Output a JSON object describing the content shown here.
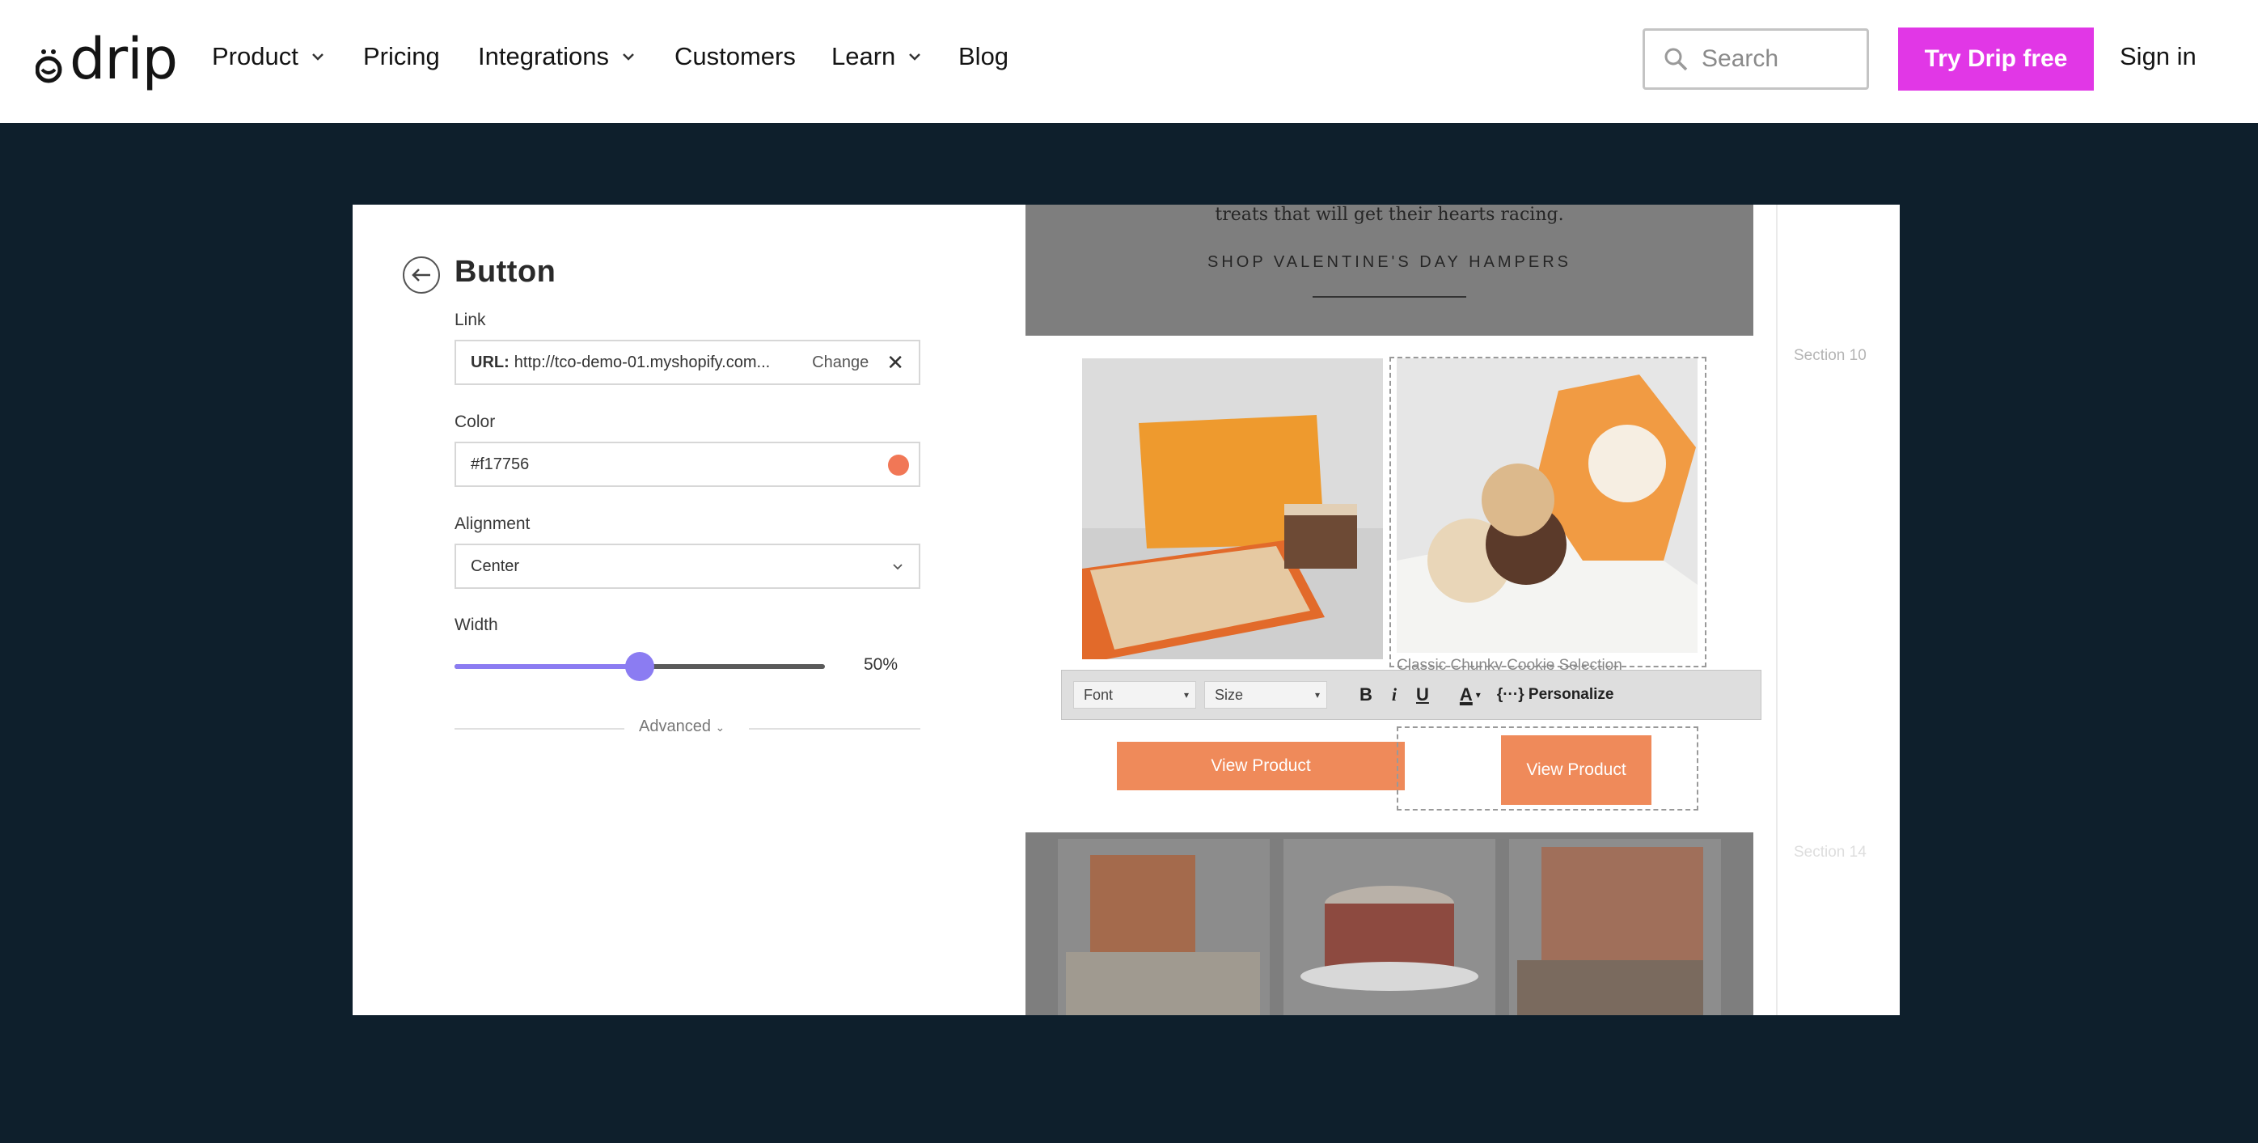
{
  "nav": {
    "logo_text": "drip",
    "items": [
      {
        "label": "Product",
        "has_dropdown": true
      },
      {
        "label": "Pricing",
        "has_dropdown": false
      },
      {
        "label": "Integrations",
        "has_dropdown": true
      },
      {
        "label": "Customers",
        "has_dropdown": false
      },
      {
        "label": "Learn",
        "has_dropdown": true
      },
      {
        "label": "Blog",
        "has_dropdown": false
      }
    ],
    "search_placeholder": "Search",
    "cta_label": "Try Drip free",
    "signin_label": "Sign in",
    "cta_color": "#e137e6"
  },
  "editor": {
    "title": "Button",
    "link_label": "Link",
    "url_key": "URL:",
    "url_value": "http://tco-demo-01.myshopify.com...",
    "change_label": "Change",
    "color_label": "Color",
    "color_value": "#f17756",
    "alignment_label": "Alignment",
    "alignment_value": "Center",
    "width_label": "Width",
    "width_value": "50%",
    "width_fraction": 0.5,
    "advanced_label": "Advanced"
  },
  "preview": {
    "tagline": "treats that will get their hearts racing.",
    "shop_link": "SHOP VALENTINE'S DAY HAMPERS",
    "product_title": "Classic Chunky Cookie Selection",
    "toolbar": {
      "font_label": "Font",
      "size_label": "Size",
      "bold": "B",
      "italic": "i",
      "underline": "U",
      "text_color": "A",
      "personalize_label": "Personalize"
    },
    "button_left_label": "View Product",
    "button_right_label": "View Product",
    "button_color": "#ef8a5a"
  },
  "sections": [
    "Section 10",
    "Section 14"
  ]
}
